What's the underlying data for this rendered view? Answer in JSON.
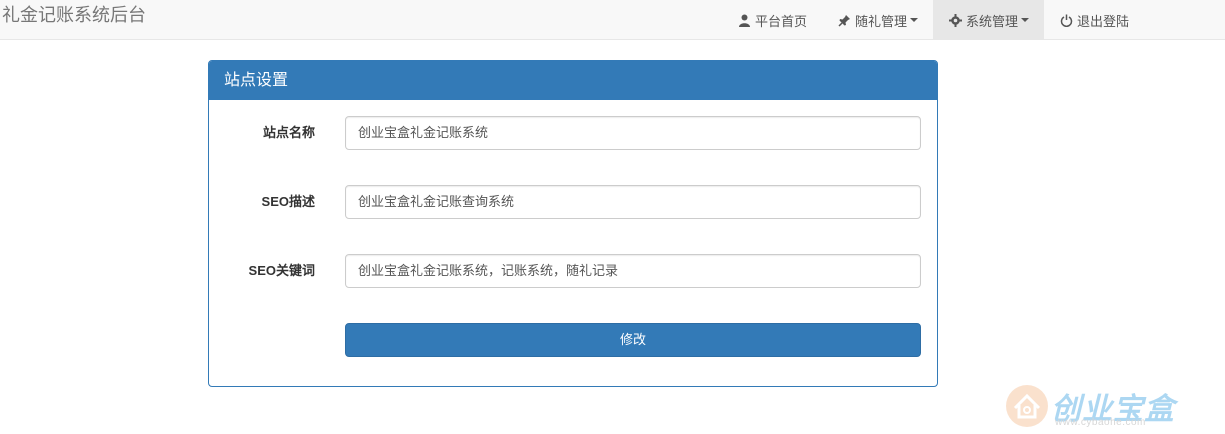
{
  "navbar": {
    "brand": "礼金记账系统后台",
    "items": [
      {
        "label": "平台首页",
        "icon": "user-icon"
      },
      {
        "label": "随礼管理",
        "icon": "pushpin-icon",
        "dropdown": true
      },
      {
        "label": "系统管理",
        "icon": "cog-icon",
        "dropdown": true,
        "active": true
      },
      {
        "label": "退出登陆",
        "icon": "power-icon"
      }
    ]
  },
  "panel": {
    "title": "站点设置",
    "fields": [
      {
        "label": "站点名称",
        "value": "创业宝盒礼金记账系统"
      },
      {
        "label": "SEO描述",
        "value": "创业宝盒礼金记账查询系统"
      },
      {
        "label": "SEO关键词",
        "value": "创业宝盒礼金记账系统，记账系统，随礼记录"
      }
    ],
    "submit_label": "修改"
  },
  "watermark": {
    "text": "创业宝盒",
    "url": "www.cybaohe.com"
  },
  "colors": {
    "primary": "#337ab7",
    "navbar_bg": "#f8f8f8",
    "active_nav_bg": "#e7e7e7"
  }
}
